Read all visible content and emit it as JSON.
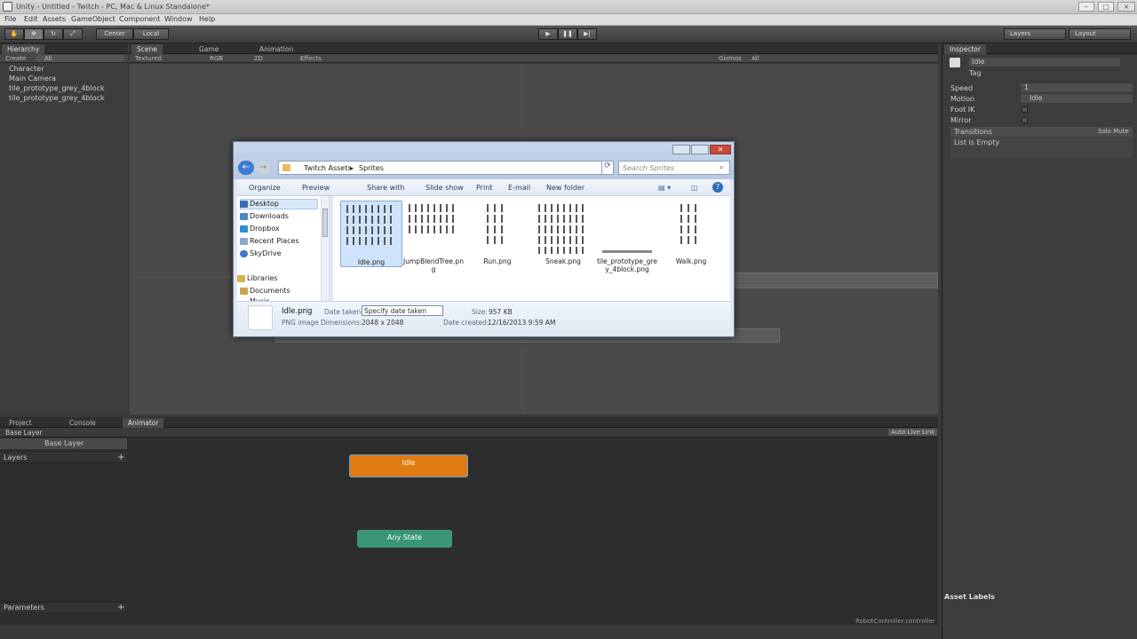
{
  "window": {
    "title": "Unity - Untitled - Twitch - PC, Mac & Linux Standalone*"
  },
  "menu": [
    "File",
    "Edit",
    "Assets",
    "GameObject",
    "Component",
    "Window",
    "Help"
  ],
  "toolbar": {
    "pivot": "Center",
    "space": "Local",
    "layers": "Layers",
    "layout": "Layout"
  },
  "hierarchy": {
    "tab": "Hierarchy",
    "create": "Create",
    "search": "All",
    "items": [
      "Character",
      "Main Camera",
      "tile_prototype_grey_4block",
      "tile_prototype_grey_4block"
    ]
  },
  "scene": {
    "tabs": [
      "Scene",
      "Game",
      "Animation"
    ],
    "render_mode": "Textured",
    "color_mode": "RGB",
    "mode_2d": "2D",
    "effects": "Effects",
    "gizmos": "Gizmos",
    "gizmo_search": "All"
  },
  "bottom_tabs": [
    "Project",
    "Console",
    "Animator"
  ],
  "animator": {
    "breadcrumb": "Base Layer",
    "layer_name": "Base Layer",
    "layers_label": "Layers",
    "parameters_label": "Parameters",
    "auto_live_link": "Auto Live Link",
    "states": [
      "Idle",
      "Any State"
    ],
    "controller_file": "RobotController.controller"
  },
  "inspector": {
    "tab": "Inspector",
    "name": "Idle",
    "tag": "Tag",
    "fields": [
      {
        "label": "Speed",
        "value": "1"
      },
      {
        "label": "Motion",
        "value": "Idle"
      },
      {
        "label": "Foot IK",
        "value": ""
      },
      {
        "label": "Mirror",
        "value": ""
      }
    ],
    "transitions": "Transitions",
    "solo_mute": "Solo Mute",
    "list_empty": "List is Empty",
    "asset_labels": "Asset Labels"
  },
  "dialog": {
    "breadcrumb": [
      "Twitch Assets",
      "Sprites"
    ],
    "search_placeholder": "Search Sprites",
    "commands": [
      "Organize",
      "Preview",
      "Share with",
      "Slide show",
      "Print",
      "E-mail",
      "New folder"
    ],
    "nav": [
      "Desktop",
      "Downloads",
      "Dropbox",
      "Recent Places",
      "SkyDrive",
      "Libraries",
      "Documents",
      "Music"
    ],
    "files": [
      "Idle.png",
      "JumpBlendTree.png",
      "Run.png",
      "Sneak.png",
      "tile_prototype_grey_4block.png",
      "Walk.png"
    ],
    "details": {
      "name": "Idle.png",
      "type": "PNG image",
      "date_taken_label": "Date taken:",
      "date_taken_value": "Specify date taken",
      "dimensions_label": "Dimensions:",
      "dimensions_value": "2048 x 2048",
      "size_label": "Size:",
      "size_value": "957 KB",
      "created_label": "Date created:",
      "created_value": "12/16/2013 9:59 AM"
    }
  },
  "colors": {
    "idle_state": "#e07b12",
    "any_state": "#3b9677",
    "dialog_close": "#c94a3a"
  }
}
